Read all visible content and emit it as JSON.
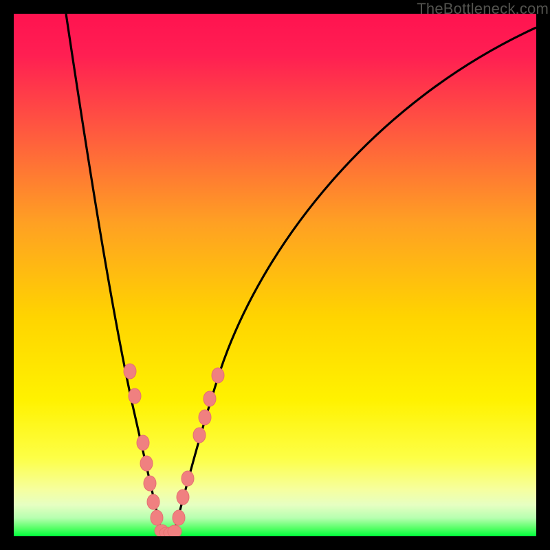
{
  "watermark": "TheBottleneck.com",
  "colors": {
    "black": "#000000",
    "curve": "#000000",
    "marker_fill": "#f08080",
    "marker_stroke": "#e06868",
    "green_band": "#00ff3c"
  },
  "chart_data": {
    "type": "line",
    "title": "",
    "xlabel": "",
    "ylabel": "",
    "xlim": [
      0,
      100
    ],
    "ylim": [
      0,
      100
    ],
    "legend": false,
    "grid": false,
    "background_gradient": {
      "top": "#ff1a55",
      "mid_upper": "#ff8c2a",
      "mid": "#ffe000",
      "mid_lower": "#ffff70",
      "bottom": "#00ff3c"
    },
    "series": [
      {
        "name": "left-branch",
        "note": "descending arc from top-left into the minimum",
        "x": [
          10,
          12,
          14,
          16,
          18,
          20,
          22,
          24,
          25.5,
          27,
          28.3
        ],
        "y": [
          100,
          88,
          77,
          66,
          55,
          44,
          33,
          22,
          13,
          5,
          0
        ]
      },
      {
        "name": "right-branch",
        "note": "ascending arc from the minimum out to top-right",
        "x": [
          30.7,
          32,
          34,
          37,
          41,
          46,
          53,
          62,
          73,
          86,
          100
        ],
        "y": [
          0,
          5,
          13,
          23,
          34,
          45,
          56,
          68,
          80,
          91,
          100
        ]
      },
      {
        "name": "valley-floor",
        "x": [
          28.3,
          30.7
        ],
        "y": [
          0,
          0
        ]
      }
    ],
    "markers": {
      "name": "highlighted-points",
      "color": "#f08080",
      "points": [
        {
          "x": 22.2,
          "y": 32.0
        },
        {
          "x": 23.1,
          "y": 27.0
        },
        {
          "x": 24.7,
          "y": 18.0
        },
        {
          "x": 25.4,
          "y": 14.0
        },
        {
          "x": 26.1,
          "y": 10.0
        },
        {
          "x": 26.7,
          "y": 6.5
        },
        {
          "x": 27.3,
          "y": 3.5
        },
        {
          "x": 28.3,
          "y": 0.7
        },
        {
          "x": 29.2,
          "y": 0.5
        },
        {
          "x": 30.0,
          "y": 0.5
        },
        {
          "x": 30.7,
          "y": 0.7
        },
        {
          "x": 31.6,
          "y": 3.5
        },
        {
          "x": 32.4,
          "y": 7.5
        },
        {
          "x": 33.3,
          "y": 11.0
        },
        {
          "x": 35.5,
          "y": 19.5
        },
        {
          "x": 36.5,
          "y": 23.0
        },
        {
          "x": 37.5,
          "y": 26.5
        },
        {
          "x": 39.0,
          "y": 31.0
        }
      ]
    }
  }
}
